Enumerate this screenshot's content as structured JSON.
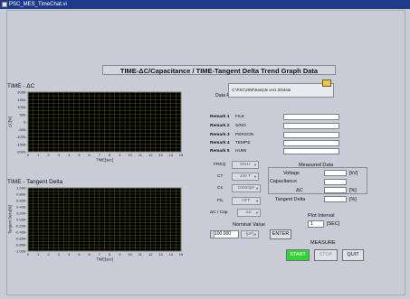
{
  "window": {
    "title": "PSC_MES_TimeChat.vi"
  },
  "main_title": "TIME-ΔC/Capacitance / TIME-Tangent Delta Trend Graph Data",
  "graph1": {
    "title": "TIME - ΔC",
    "ylabel": "ΔC[%]",
    "xlabel": "TIME[sec]",
    "yticks": [
      "2000-",
      "1500-",
      "1000-",
      "500-",
      "0-",
      "-500-",
      "-1000-",
      "-1500-",
      "-2000-"
    ],
    "xticks": [
      "0",
      "1",
      "2",
      "3",
      "4",
      "5",
      "6",
      "7",
      "8",
      "9",
      "10",
      "11",
      "12",
      "13",
      "14",
      "15"
    ]
  },
  "graph2": {
    "title": "TIME - Tangent Delta",
    "ylabel": "Tangent Delta[%]",
    "xlabel": "TIME[sec]",
    "yticks": [
      "1.000-",
      "0.800-",
      "0.600-",
      "0.400-",
      "0.200-",
      "0.000-",
      "-0.200-",
      "-0.400-",
      "-0.600-",
      "-0.800-",
      "-1.000-"
    ],
    "xticks": [
      "0",
      "1",
      "2",
      "3",
      "4",
      "5",
      "6",
      "7",
      "8",
      "9",
      "10",
      "11",
      "12",
      "13",
      "14",
      "15"
    ]
  },
  "data_folder": {
    "label": "Data Folder",
    "path": "C:\\PSC\\20W\\Sample ver1.00\\data"
  },
  "remarks": [
    {
      "num": "Remark 1",
      "name": "FILE",
      "value": ""
    },
    {
      "num": "Remark 2",
      "name": "S/NO",
      "value": ""
    },
    {
      "num": "Remark 3",
      "name": "PERSON",
      "value": ""
    },
    {
      "num": "Remark 4",
      "name": "TEMPE",
      "value": ""
    },
    {
      "num": "Remark 5",
      "name": "HUMI",
      "value": ""
    }
  ],
  "settings": {
    "freq": {
      "label": "FREQ",
      "value": "50Hz"
    },
    "ct": {
      "label": "CT",
      "value": "100 T"
    },
    "cs": {
      "label": "Cs",
      "value": "10000pF"
    },
    "fil": {
      "label": "FIL",
      "value": "OFF"
    },
    "dc_cap": {
      "label": "ΔC / Cap",
      "value": "ΔC"
    }
  },
  "measured": {
    "title": "Measured Data",
    "voltage": {
      "label": "Voltage",
      "unit": "[kV]",
      "value": ""
    },
    "capacitance": {
      "label": "Capacitance",
      "value": ""
    },
    "dc": {
      "label": "ΔC",
      "unit": "[%]",
      "value": ""
    },
    "tangent": {
      "label": "Tangent Delta",
      "unit": "[%]",
      "value": ""
    }
  },
  "plot_interval": {
    "label": "Plot Interval",
    "value": "1",
    "unit": "[SEC]"
  },
  "nominal": {
    "label": "Nominal Value",
    "value": "100.000",
    "unit": "[pF]"
  },
  "buttons": {
    "enter": "ENTER",
    "measure": "MEASURE",
    "start": "START",
    "stop": "STOP",
    "quit": "QUIT"
  }
}
